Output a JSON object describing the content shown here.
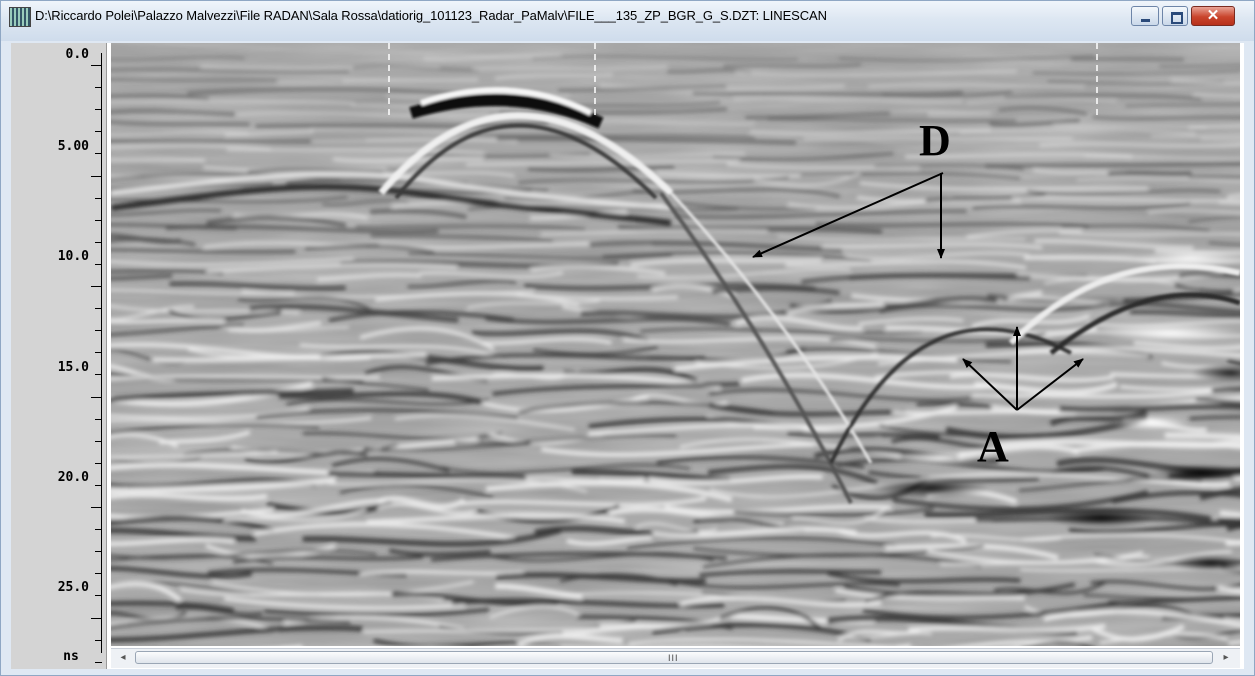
{
  "window": {
    "title": "D:\\Riccardo Polei\\Palazzo Malvezzi\\File RADAN\\Sala Rossa\\datiorig_101123_Radar_PaMalv\\FILE___135_ZP_BGR_G_S.DZT:  LINESCAN",
    "icon": "radan-app-icon",
    "controls": {
      "minimize": "minimize-icon",
      "maximize": "maximize-icon",
      "close_glyph": "✕"
    }
  },
  "ruler": {
    "labels": [
      "0.0",
      "5.00",
      "10.0",
      "15.0",
      "20.0",
      "25.0"
    ],
    "unit": "ns"
  },
  "annotations": {
    "d_label": "D",
    "a_label": "A"
  },
  "scrollbar": {
    "grip": "III",
    "left_arrow": "◂",
    "right_arrow": "▸"
  }
}
